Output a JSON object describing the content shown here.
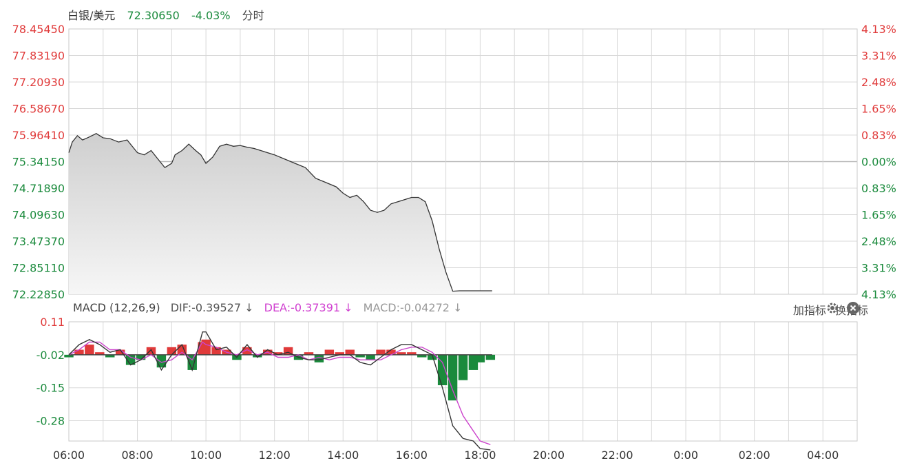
{
  "header": {
    "symbol": "白银/美元",
    "price": "72.30650",
    "change": "-4.03%",
    "mode": "分时",
    "symbol_color": "#333333",
    "price_color": "#1a8a3c"
  },
  "macd_header": {
    "name": "MACD (12,26,9)",
    "dif": "DIF:-0.39527 ↓",
    "dea": "DEA:-0.37391 ↓",
    "macd": "MACD:-0.04272 ↓",
    "add_indicator": "加指标",
    "switch_indicator": "换指标",
    "gear_icon": "gear-icon",
    "close_icon": "close-icon",
    "dif_color": "#555555",
    "dea_color": "#d040d0",
    "macd_color": "#999999"
  },
  "colors": {
    "up": "#e03a3a",
    "down": "#1a8a3c",
    "grid": "#d8d8d8",
    "price_line": "#333333",
    "dea_line": "#cc44cc"
  },
  "chart_data": [
    {
      "type": "area",
      "title": "",
      "x_ticks": [
        "06:00",
        "08:00",
        "10:00",
        "12:00",
        "14:00",
        "16:00",
        "18:00",
        "20:00",
        "22:00",
        "0:00",
        "02:00",
        "04:00"
      ],
      "ylim": [
        72.2285,
        78.4545
      ],
      "y_ticks_left": [
        "78.45450",
        "77.83190",
        "77.20930",
        "76.58670",
        "75.96410",
        "75.34150",
        "74.71890",
        "74.09630",
        "73.47370",
        "72.85110",
        "72.22850"
      ],
      "y_ticks_right": [
        "4.13%",
        "3.31%",
        "2.48%",
        "1.65%",
        "0.83%",
        "0.00%",
        "0.83%",
        "1.65%",
        "2.48%",
        "3.31%",
        "4.13%"
      ],
      "reference_price": 75.3415,
      "hours_span": 23,
      "series": [
        {
          "hours": [
            0,
            0.1,
            0.25,
            0.4,
            0.6,
            0.8,
            1,
            1.2,
            1.45,
            1.7,
            2,
            2.2,
            2.4,
            2.6,
            2.8,
            3,
            3.1,
            3.3,
            3.5,
            3.7,
            3.85,
            4,
            4.2,
            4.4,
            4.6,
            4.8,
            5,
            5.2,
            5.4,
            5.6,
            5.8,
            6,
            6.3,
            6.6,
            6.9,
            7.2,
            7.5,
            7.8,
            8.0,
            8.2,
            8.4,
            8.6,
            8.8,
            9.0,
            9.2,
            9.4,
            9.6,
            9.8,
            10.0,
            10.2,
            10.4,
            10.6,
            10.8,
            11.0,
            11.2,
            11.4,
            11.6,
            11.8,
            11.9,
            12.0,
            12.05,
            12.1,
            12.2,
            12.3,
            12.35
          ],
          "values": [
            75.55,
            75.8,
            75.95,
            75.85,
            75.92,
            76.0,
            75.9,
            75.88,
            75.8,
            75.85,
            75.55,
            75.5,
            75.6,
            75.4,
            75.2,
            75.3,
            75.5,
            75.6,
            75.75,
            75.6,
            75.5,
            75.3,
            75.45,
            75.7,
            75.75,
            75.7,
            75.72,
            75.68,
            75.65,
            75.6,
            75.55,
            75.5,
            75.4,
            75.3,
            75.2,
            74.95,
            74.85,
            74.75,
            74.6,
            74.5,
            74.55,
            74.4,
            74.2,
            74.15,
            74.2,
            74.35,
            74.4,
            74.45,
            74.5,
            74.5,
            74.4,
            73.95,
            73.3,
            72.75,
            72.3,
            72.31,
            72.31,
            72.31,
            72.31,
            72.31,
            72.31,
            72.31,
            72.31,
            72.31,
            72.31
          ]
        }
      ]
    },
    {
      "type": "bar",
      "title": "MACD (12,26,9)",
      "ylim": [
        -0.36,
        0.11
      ],
      "y_ticks": [
        "0.11",
        "-0.02",
        "-0.15",
        "-0.28"
      ],
      "y_tick_values": [
        0.11,
        -0.02,
        -0.15,
        -0.28
      ],
      "hours": [
        0,
        0.3,
        0.6,
        0.9,
        1.2,
        1.5,
        1.8,
        2.1,
        2.4,
        2.7,
        3.0,
        3.3,
        3.6,
        3.9,
        4.0,
        4.3,
        4.6,
        4.9,
        5.2,
        5.5,
        5.8,
        6.1,
        6.4,
        6.7,
        7.0,
        7.3,
        7.6,
        7.9,
        8.2,
        8.5,
        8.8,
        9.1,
        9.4,
        9.7,
        10.0,
        10.3,
        10.6,
        10.9,
        11.2,
        11.5,
        11.8,
        12.0,
        12.3
      ],
      "macd": [
        -0.01,
        0.02,
        0.04,
        0.01,
        -0.01,
        0.02,
        -0.04,
        -0.02,
        0.03,
        -0.05,
        0.03,
        0.04,
        -0.06,
        0.05,
        0.06,
        0.03,
        0.02,
        -0.02,
        0.03,
        -0.01,
        0.02,
        0.01,
        0.03,
        -0.02,
        0.01,
        -0.03,
        0.02,
        0.01,
        0.02,
        -0.01,
        -0.02,
        0.02,
        0.02,
        0.01,
        0.01,
        -0.01,
        -0.02,
        -0.12,
        -0.18,
        -0.1,
        -0.06,
        -0.03,
        -0.02
      ],
      "dif": [
        -0.02,
        0.02,
        0.04,
        0.02,
        -0.01,
        0.0,
        -0.06,
        -0.04,
        0.0,
        -0.08,
        -0.02,
        0.02,
        -0.08,
        0.07,
        0.07,
        0.0,
        0.01,
        -0.03,
        0.02,
        -0.03,
        0.0,
        -0.02,
        -0.01,
        -0.03,
        -0.04,
        -0.04,
        -0.03,
        -0.02,
        -0.02,
        -0.05,
        -0.06,
        -0.03,
        0.0,
        0.02,
        0.02,
        0.0,
        -0.02,
        -0.15,
        -0.3,
        -0.35,
        -0.36,
        -0.39,
        -0.395
      ],
      "dea": [
        -0.02,
        0.0,
        0.03,
        0.03,
        0.0,
        0.0,
        -0.03,
        -0.04,
        -0.02,
        -0.05,
        -0.04,
        -0.01,
        -0.04,
        0.03,
        0.02,
        0.01,
        -0.01,
        -0.02,
        0.0,
        -0.02,
        -0.01,
        -0.03,
        -0.03,
        -0.02,
        -0.04,
        -0.03,
        -0.04,
        -0.03,
        -0.03,
        -0.04,
        -0.04,
        -0.04,
        -0.02,
        0.0,
        0.01,
        0.01,
        -0.01,
        -0.05,
        -0.16,
        -0.26,
        -0.32,
        -0.36,
        -0.374
      ]
    }
  ]
}
